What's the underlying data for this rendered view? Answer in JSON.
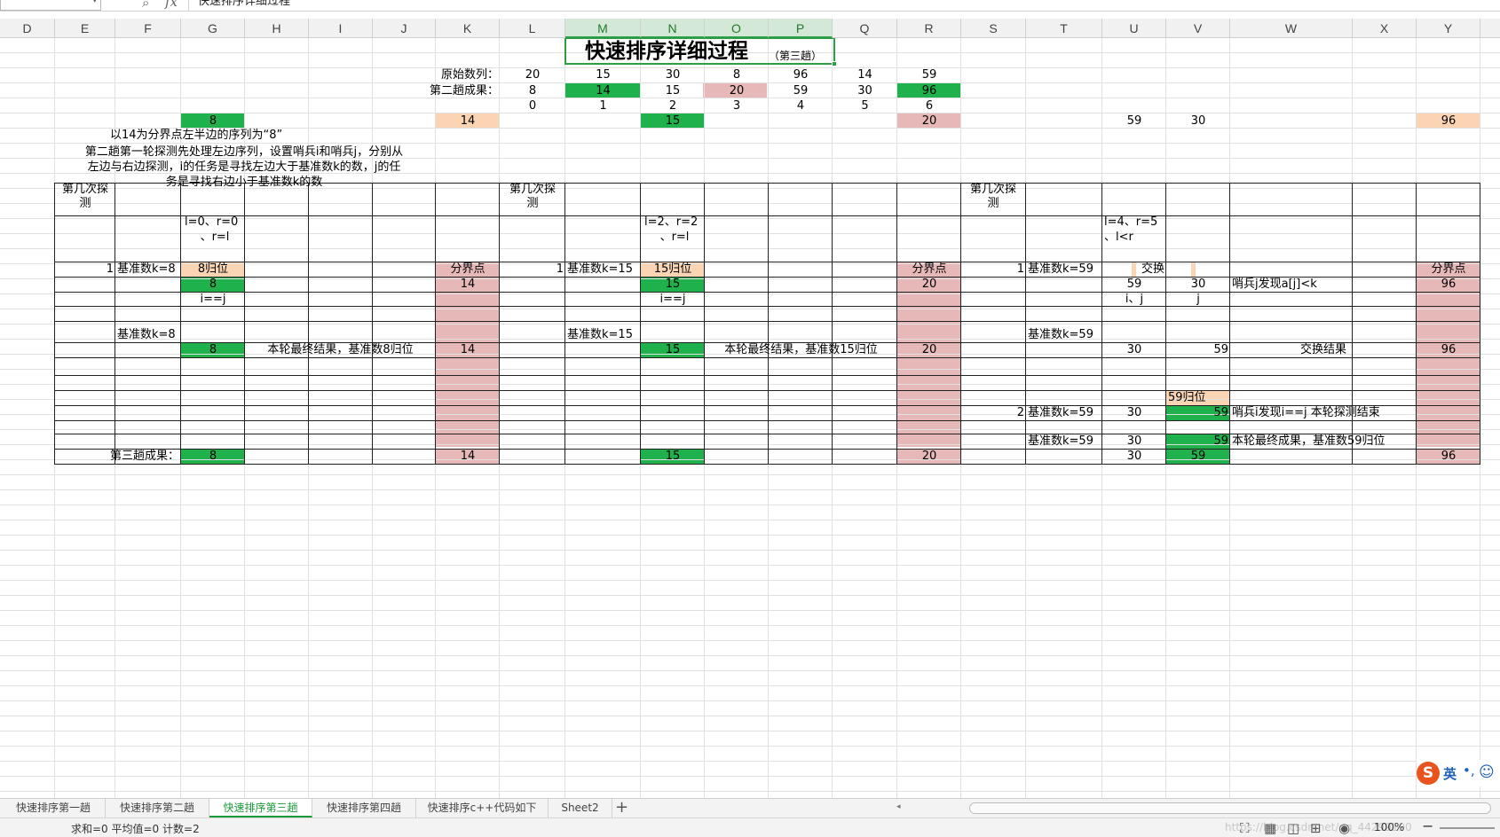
{
  "formula_bar": {
    "name_box": "",
    "formula": "快速排序详细过程"
  },
  "columns": [
    "D",
    "E",
    "F",
    "G",
    "H",
    "I",
    "J",
    "K",
    "L",
    "M",
    "N",
    "O",
    "P",
    "Q",
    "R",
    "S",
    "T",
    "U",
    "V",
    "W",
    "X",
    "Y"
  ],
  "selected_columns": [
    "M",
    "N",
    "O",
    "P"
  ],
  "colors": {
    "green": "#1fb14c",
    "pink": "#e6b9b8",
    "orange": "#fbd4b4",
    "accent": "#1a9b3a"
  },
  "sheet": {
    "title": "快速排序详细过程",
    "subtitle": "（第三趟）",
    "labels": {
      "original_sequence": "原始数列：",
      "second_pass_result": "第二趟成果：",
      "left_half_note": "以14为分界点左半边的序列为“8”",
      "explanation": "第二趟第一轮探测先处理左边序列，设置哨兵i和哨兵j，分别从左边与右边探测，i的任务是寻找左边大于基准数k的数，j的任务是寻找右边小于基准数k的数",
      "explanation_line1": "第二趟第一轮探测先处理左边序列，设置哨兵i和哨兵j，分别从",
      "explanation_line2": "左边与右边探测，i的任务是寻找左边大于基准数k的数，j的任",
      "explanation_line3": "务是寻找右边小于基准数k的数",
      "probe_count_1": "第几次探",
      "probe_count_2": "测",
      "third_pass_result": "第三趟成果："
    },
    "original_values": [
      "20",
      "15",
      "30",
      "8",
      "96",
      "14",
      "59"
    ],
    "second_pass_values": [
      "8",
      "14",
      "15",
      "20",
      "59",
      "30",
      "96"
    ],
    "index_values": [
      "0",
      "1",
      "2",
      "3",
      "4",
      "5",
      "6"
    ],
    "row4": {
      "g": "8",
      "k": "14",
      "n": "15",
      "r": "20",
      "u": "59",
      "v": "30",
      "y": "96"
    },
    "block1": {
      "range_1": "l=0、r=0",
      "range_2": "、r=l",
      "round": "1",
      "pivot": "基准数k=8",
      "homed": "8归位",
      "boundary": "分界点",
      "g_val": "8",
      "k_val": "14",
      "ij": "i==j",
      "pivot2": "基准数k=8",
      "final_val": "8",
      "final_note": "本轮最终结果，基准数8归位",
      "final_k": "14"
    },
    "block2": {
      "range_1": "l=2、r=2",
      "range_2": "、r=l",
      "round": "1",
      "pivot": "基准数k=15",
      "homed": "15归位",
      "boundary": "分界点",
      "n_val": "15",
      "r_val": "20",
      "ij": "i==j",
      "pivot2": "基准数k=15",
      "final_val": "15",
      "final_note": "本轮最终结果，基准数15归位",
      "final_r": "20"
    },
    "block3": {
      "range_1": "l=4、r=5",
      "range_2": "、l<r",
      "round": "1",
      "pivot": "基准数k=59",
      "swap": "交换",
      "boundary": "分界点",
      "u_val": "59",
      "v_val": "30",
      "j_found": "哨兵j发现a[j]<k",
      "y_val": "96",
      "i_j": "i、j",
      "j": "j",
      "pivot2": "基准数k=59",
      "sw_u": "30",
      "sw_v": "59",
      "swap_result": "交换结果",
      "sw_y": "96",
      "homed59": "59归位",
      "round2": "2",
      "pivot3": "基准数k=59",
      "r2_u": "30",
      "r2_v": "59",
      "r2_note": "哨兵i发现i==j 本轮探测结束",
      "pivot4": "基准数k=59",
      "f_u": "30",
      "f_v": "59",
      "f_note": "本轮最终成果，基准数59归位"
    },
    "third_pass": {
      "g": "8",
      "k": "14",
      "n": "15",
      "r": "20",
      "u": "30",
      "v": "59",
      "y": "96"
    }
  },
  "tabs": [
    "快速排序第一趟",
    "快速排序第二趟",
    "快速排序第三趟",
    "快速排序第四趟",
    "快速排序c++代码如下",
    "Sheet2"
  ],
  "active_tab": "快速排序第三趟",
  "status": {
    "summary": "求和=0  平均值=0  计数=2",
    "zoom": "100%",
    "watermark": "https://blog.csdn.net/qq_44299190"
  },
  "ime": {
    "lang": "英",
    "punct": "•,"
  },
  "icons": [
    "zoom-icon",
    "fx-icon",
    "add-sheet-icon",
    "fullscreen-icon",
    "normal-view-icon",
    "page-layout-icon",
    "page-break-icon",
    "eye-icon"
  ]
}
